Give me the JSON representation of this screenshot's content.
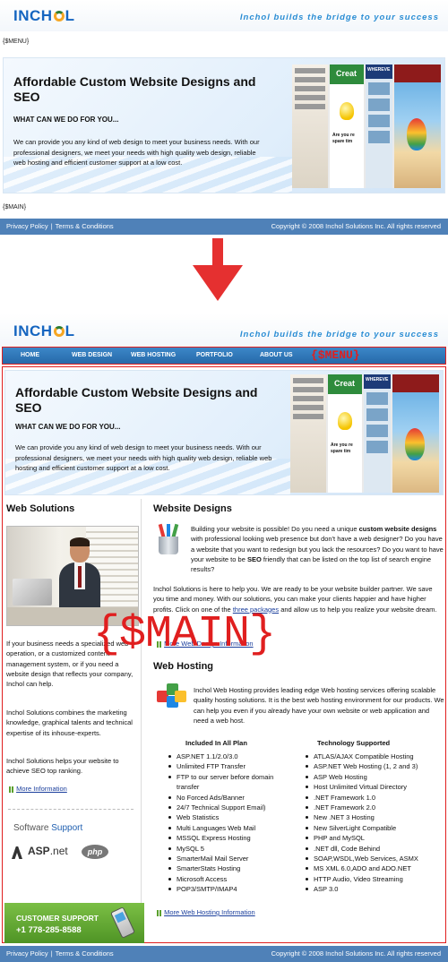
{
  "brand": {
    "logo_text": "INCHOL",
    "tagline": "Inchol builds the bridge to your success"
  },
  "before": {
    "menu_placeholder": "{$MENU}",
    "main_placeholder": "{$MAIN}"
  },
  "hero": {
    "title_before": "Affordable Custom Website Designs and SEO",
    "title_after": "Affordable Custom Website Designs and SEO",
    "subtitle": "WHAT CAN WE DO FOR YOU...",
    "text": "We can provide you any kind of web design to meet your business needs. With our professional designers, we meet your needs with high quality web design, reliable web hosting and efficient customer support at a low cost.",
    "collage": {
      "tile2_head": "Creat",
      "tile2_text": "Are you re spare tim",
      "tile3_head": "WHEREVE",
      "tile3_sub": "Enviro"
    }
  },
  "footer": {
    "privacy": "Privacy Policy",
    "terms": "Terms & Conditions",
    "separator": "|",
    "copyright": "Copyright © 2008 Inchol Solutions Inc. All rights reserved"
  },
  "nav": {
    "items": [
      "HOME",
      "WEB DESIGN",
      "WEB HOSTING",
      "PORTFOLIO",
      "ABOUT US"
    ],
    "menu_tag": "{$MENU}"
  },
  "main_tag": "{$MAIN}",
  "sidebar": {
    "title": "Web Solutions",
    "para1": "If your business needs a specialized web operation, or a customized content management system, or if you need a website design that reflects your company, Inchol can help.",
    "para2": "Inchol Solutions combines the marketing knowledge, graphical talents and technical expertise of its inhouse-experts.",
    "para3": "Inchol Solutions helps your website to achieve SEO top ranking.",
    "more_info": "More Information",
    "software_support_a": "Software",
    "software_support_b": "Support",
    "logo_asp": "ASP",
    "logo_net": ".net",
    "logo_php": "php",
    "customer_support": "CUSTOMER SUPPORT",
    "phone": "+1 778-285-8588"
  },
  "content": {
    "designs_title": "Website Designs",
    "designs_p1a": "Building your website is possible! Do you need a unique",
    "designs_p1b": "custom website designs",
    "designs_p1c": "with professional looking web presence but don't have a web designer? Do you have a website that you want to redesign but you lack the resources? Do you want to have your website to be",
    "designs_p1d": "SEO",
    "designs_p1e": "friendly that can be listed on the top list of search engine results?",
    "designs_p2a": "Inchol Solutions is here to help you. We are ready to be your website builder partner. We save you time and money. With our solutions, you can make your clients happier and have higher profits. Click on one of the",
    "designs_p2b": "three packages",
    "designs_p2c": "and allow us to help you realize your website dream.",
    "designs_more": "More Web Design Information",
    "hosting_title": "Web Hosting",
    "hosting_p": "Inchol Web Hosting provides leading edge Web hosting services offering scalable quality hosting solutions. It is the best web hosting environment for our products. We can help you even if you already have your own website or web application and need a web host.",
    "col1_head": "Included In All Plan",
    "col1_items": [
      "ASP.NET 1.1/2.0/3.0",
      "Unlimited FTP Transfer",
      "FTP to our server before domain transfer",
      "No Forced Ads/Banner",
      "24/7 Technical Support Email)",
      "Web Statistics",
      "Multi Languages Web Mail",
      "MSSQL Express Hosting",
      "MySQL 5",
      "SmarterMail Mail Server",
      "SmarterStats Hosting",
      "Microsoft Access",
      "POP3/SMTP/IMAP4"
    ],
    "col2_head": "Technology Supported",
    "col2_items": [
      "ATLAS/AJAX Compatible Hosting",
      "ASP.NET Web Hosting (1, 2 and 3)",
      "ASP Web Hosting",
      "Host Unlimited Virtual Directory",
      ".NET Framework 1.0",
      ".NET Framework 2.0",
      "New .NET 3 Hosting",
      "New SilverLight Compatible",
      "PHP and MySQL",
      ".NET dll, Code Behind",
      "SOAP,WSDL,Web Services, ASMX",
      "MS XML 6.0,ADO and ADO.NET",
      "HTTP Audio, Video Streaming",
      "ASP 3.0"
    ],
    "hosting_more": "More Web Hosting Information"
  },
  "colors": {
    "brand_blue": "#1565c0",
    "footer_blue": "#4f81b8",
    "nav_blue": "#2f78bb",
    "annotation_red": "#e01f1f",
    "support_green": "#5aa02c"
  }
}
